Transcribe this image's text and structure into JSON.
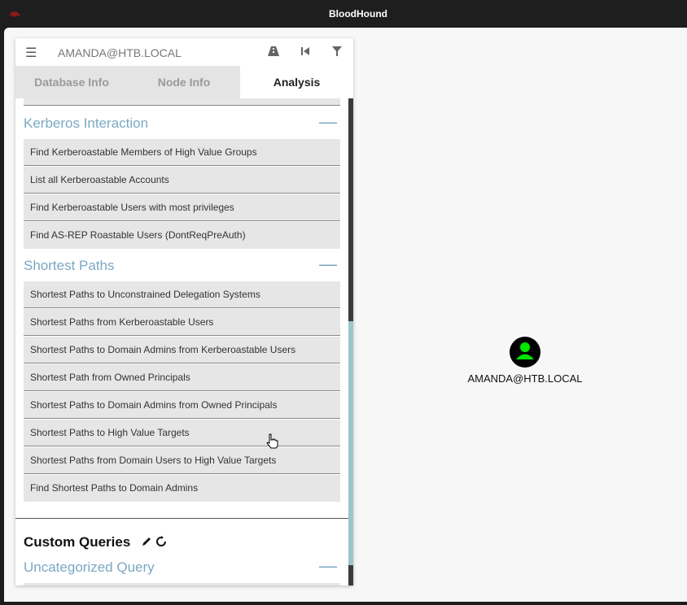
{
  "window": {
    "title": "BloodHound"
  },
  "search": {
    "value": "AMANDA@HTB.LOCAL"
  },
  "tabs": [
    {
      "label": "Database Info",
      "active": false
    },
    {
      "label": "Node Info",
      "active": false
    },
    {
      "label": "Analysis",
      "active": true
    }
  ],
  "sections": {
    "kerberos": {
      "title": "Kerberos Interaction",
      "toggle": "—",
      "queries": [
        "Find Kerberoastable Members of High Value Groups",
        "List all Kerberoastable Accounts",
        "Find Kerberoastable Users with most privileges",
        "Find AS-REP Roastable Users (DontReqPreAuth)"
      ]
    },
    "shortest": {
      "title": "Shortest Paths",
      "toggle": "—",
      "queries": [
        "Shortest Paths to Unconstrained Delegation Systems",
        "Shortest Paths from Kerberoastable Users",
        "Shortest Paths to Domain Admins from Kerberoastable Users",
        "Shortest Path from Owned Principals",
        "Shortest Paths to Domain Admins from Owned Principals",
        "Shortest Paths to High Value Targets",
        "Shortest Paths from Domain Users to High Value Targets",
        "Find Shortest Paths to Domain Admins"
      ]
    },
    "custom": {
      "title": "Custom Queries",
      "uncategorized": "Uncategorized Query",
      "toggle": "—"
    }
  },
  "graph": {
    "node_label": "AMANDA@HTB.LOCAL",
    "node_color": "#00e600"
  },
  "colors": {
    "accent": "#7ba8c4",
    "scroll_thumb": "#9cc5cc"
  }
}
